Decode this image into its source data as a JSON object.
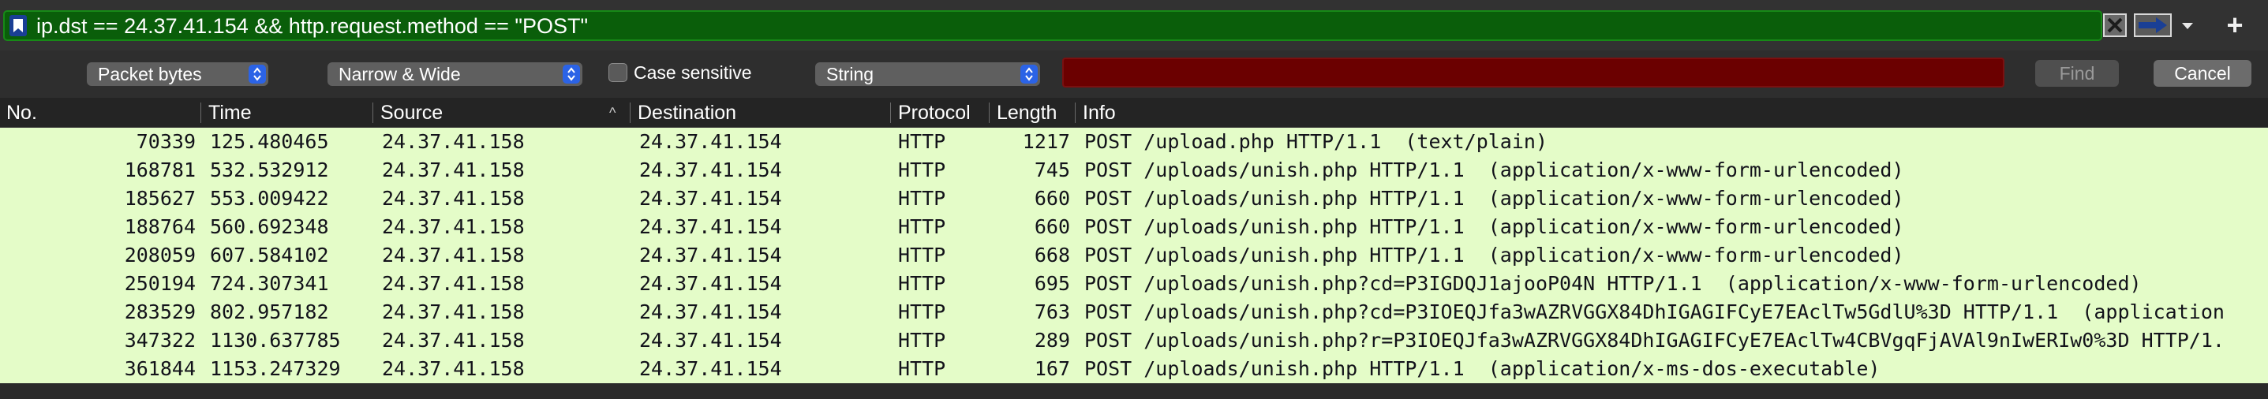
{
  "filter": {
    "text": "ip.dst == 24.37.41.154 && http.request.method == \"POST\"",
    "icons": {
      "bookmark": "bookmark-icon",
      "clear": "clear-x-icon",
      "apply": "arrow-right-icon",
      "recent": "chevron-down-icon",
      "add": "plus-icon"
    },
    "colors": {
      "valid_bg": "#0a5e0a"
    }
  },
  "find": {
    "search_in": "Packet bytes",
    "char_width": "Narrow & Wide",
    "case_sensitive_label": "Case sensitive",
    "case_sensitive_checked": false,
    "search_type": "String",
    "search_value": "",
    "find_label": "Find",
    "cancel_label": "Cancel",
    "colors": {
      "invalid_field_bg": "#6b0000",
      "select_accent": "#2b63e6"
    }
  },
  "packet_list": {
    "columns": [
      "No.",
      "Time",
      "Source",
      "Destination",
      "Protocol",
      "Length",
      "Info"
    ],
    "sorted_column": "Source",
    "row_color": "#e4fcc8",
    "rows": [
      {
        "no": "70339",
        "time": "125.480465",
        "source": "24.37.41.158",
        "destination": "24.37.41.154",
        "protocol": "HTTP",
        "length": "1217",
        "info": "POST /upload.php HTTP/1.1  (text/plain)"
      },
      {
        "no": "168781",
        "time": "532.532912",
        "source": "24.37.41.158",
        "destination": "24.37.41.154",
        "protocol": "HTTP",
        "length": "745",
        "info": "POST /uploads/unish.php HTTP/1.1  (application/x-www-form-urlencoded)"
      },
      {
        "no": "185627",
        "time": "553.009422",
        "source": "24.37.41.158",
        "destination": "24.37.41.154",
        "protocol": "HTTP",
        "length": "660",
        "info": "POST /uploads/unish.php HTTP/1.1  (application/x-www-form-urlencoded)"
      },
      {
        "no": "188764",
        "time": "560.692348",
        "source": "24.37.41.158",
        "destination": "24.37.41.154",
        "protocol": "HTTP",
        "length": "660",
        "info": "POST /uploads/unish.php HTTP/1.1  (application/x-www-form-urlencoded)"
      },
      {
        "no": "208059",
        "time": "607.584102",
        "source": "24.37.41.158",
        "destination": "24.37.41.154",
        "protocol": "HTTP",
        "length": "668",
        "info": "POST /uploads/unish.php HTTP/1.1  (application/x-www-form-urlencoded)"
      },
      {
        "no": "250194",
        "time": "724.307341",
        "source": "24.37.41.158",
        "destination": "24.37.41.154",
        "protocol": "HTTP",
        "length": "695",
        "info": "POST /uploads/unish.php?cd=P3IGDQJ1ajooP04N HTTP/1.1  (application/x-www-form-urlencoded)"
      },
      {
        "no": "283529",
        "time": "802.957182",
        "source": "24.37.41.158",
        "destination": "24.37.41.154",
        "protocol": "HTTP",
        "length": "763",
        "info": "POST /uploads/unish.php?cd=P3IOEQJfa3wAZRVGGX84DhIGAGIFCyE7EAclTw5GdlU%3D HTTP/1.1  (application"
      },
      {
        "no": "347322",
        "time": "1130.637785",
        "source": "24.37.41.158",
        "destination": "24.37.41.154",
        "protocol": "HTTP",
        "length": "289",
        "info": "POST /uploads/unish.php?r=P3IOEQJfa3wAZRVGGX84DhIGAGIFCyE7EAclTw4CBVgqFjAVAl9nIwERIw0%3D HTTP/1."
      },
      {
        "no": "361844",
        "time": "1153.247329",
        "source": "24.37.41.158",
        "destination": "24.37.41.154",
        "protocol": "HTTP",
        "length": "167",
        "info": "POST /uploads/unish.php HTTP/1.1  (application/x-ms-dos-executable)"
      }
    ]
  }
}
